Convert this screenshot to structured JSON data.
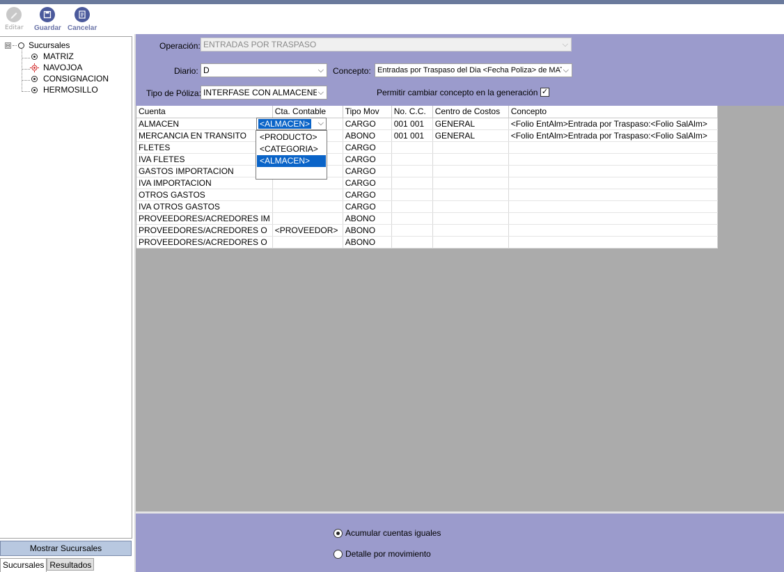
{
  "toolbar": {
    "edit_label": "Editar",
    "save_label": "Guardar",
    "cancel_label": "Cancelar"
  },
  "tree": {
    "root": {
      "label": "Sucursales",
      "expander": "⊟"
    },
    "children": [
      {
        "label": "MATRIZ",
        "state": "selected"
      },
      {
        "label": "NAVOJOA",
        "state": "active-red"
      },
      {
        "label": "CONSIGNACION",
        "state": "selected"
      },
      {
        "label": "HERMOSILLO",
        "state": "selected"
      }
    ]
  },
  "left_panel": {
    "show_branches_label": "Mostrar Sucursales",
    "tabs": [
      "Sucursales",
      "Resultados"
    ]
  },
  "form": {
    "operation_label": "Operación:",
    "operation_value": "ENTRADAS POR TRASPASO",
    "diario_label": "Diario:",
    "diario_value": "D",
    "concepto_label": "Concepto:",
    "concepto_value": "Entradas por Traspaso del Dia <Fecha Poliza> de MAT",
    "tipo_poliza_label": "Tipo de Póliza:",
    "tipo_poliza_value": "INTERFASE CON ALMACENES",
    "permitir_label": "Permitir cambiar concepto en la generación",
    "permitir_checked": "✓"
  },
  "grid": {
    "columns": [
      "Cuenta",
      "Cta. Contable",
      "Tipo Mov",
      "No. C.C.",
      "Centro de Costos",
      "Concepto"
    ],
    "rows": [
      [
        "ALMACEN",
        "",
        "CARGO",
        "001 001",
        "GENERAL",
        "<Folio EntAlm>Entrada por Traspaso:<Folio SalAlm>"
      ],
      [
        "MERCANCIA EN TRANSITO",
        "",
        "ABONO",
        "001 001",
        "GENERAL",
        "<Folio EntAlm>Entrada por Traspaso:<Folio SalAlm>"
      ],
      [
        "FLETES",
        "",
        "CARGO",
        "",
        "",
        ""
      ],
      [
        "IVA FLETES",
        "",
        "CARGO",
        "",
        "",
        ""
      ],
      [
        "GASTOS IMPORTACION",
        "",
        "CARGO",
        "",
        "",
        ""
      ],
      [
        "IVA IMPORTACION",
        "",
        "CARGO",
        "",
        "",
        ""
      ],
      [
        "OTROS GASTOS",
        "",
        "CARGO",
        "",
        "",
        ""
      ],
      [
        "IVA OTROS GASTOS",
        "",
        "CARGO",
        "",
        "",
        ""
      ],
      [
        "PROVEEDORES/ACREDORES IM",
        "",
        "ABONO",
        "",
        "",
        ""
      ],
      [
        "PROVEEDORES/ACREDORES O",
        "<PROVEEDOR>",
        "ABONO",
        "",
        "",
        ""
      ],
      [
        "PROVEEDORES/ACREDORES O",
        "",
        "ABONO",
        "",
        "",
        ""
      ]
    ],
    "editing_cell_value": "<ALMACEN>",
    "dropdown_options": [
      "<PRODUCTO>",
      "<CATEGORIA>",
      "<ALMACEN>"
    ],
    "dropdown_selected": "<ALMACEN>"
  },
  "bottom": {
    "option_accumulate": "Acumular cuentas iguales",
    "option_detail": "Detalle por movimiento",
    "selected": "accumulate"
  },
  "colors": {
    "panel": "#9b9bcc",
    "grid_bg": "#ababab",
    "selection": "#0a64c8"
  }
}
